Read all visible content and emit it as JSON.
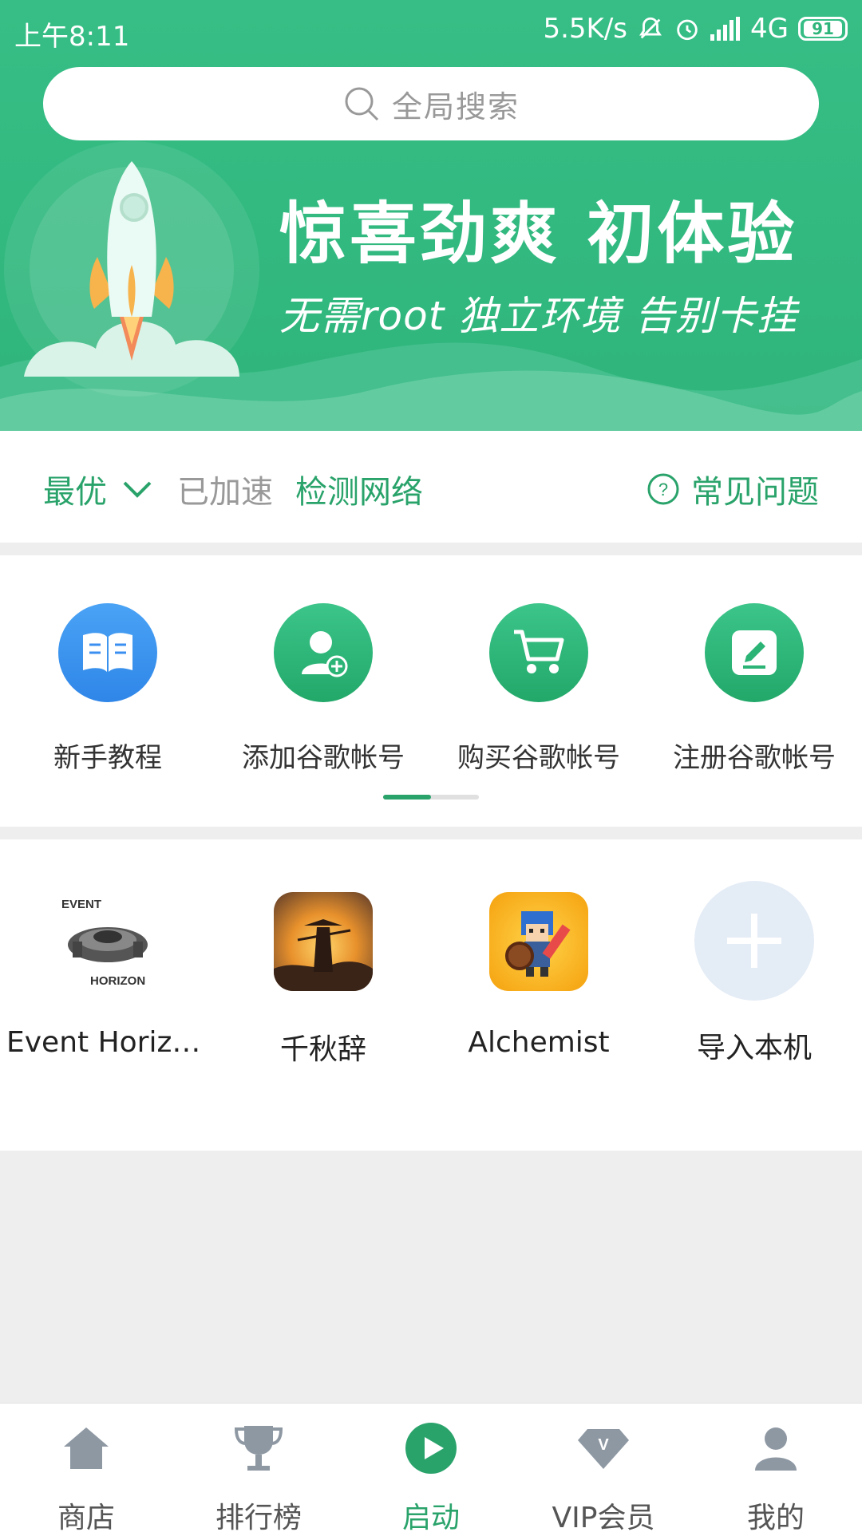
{
  "status_bar": {
    "time": "上午8:11",
    "net_speed": "5.5K/s",
    "network": "4G",
    "battery": "91"
  },
  "search": {
    "placeholder": "全局搜索"
  },
  "banner": {
    "headline": "惊喜劲爽  初体验",
    "subline": "无需root  独立环境  告别卡挂"
  },
  "network_row": {
    "mode": "最优",
    "status": "已加速",
    "check": "检测网络",
    "faq": "常见问题"
  },
  "quick_actions": [
    {
      "label": "新手教程",
      "icon": "book-icon",
      "color": "#3b8ff0"
    },
    {
      "label": "添加谷歌帐号",
      "icon": "add-user-icon",
      "color": "#2cb476"
    },
    {
      "label": "购买谷歌帐号",
      "icon": "cart-icon",
      "color": "#2cb476"
    },
    {
      "label": "注册谷歌帐号",
      "icon": "edit-icon",
      "color": "#2cb476"
    }
  ],
  "pager": {
    "active_page": 1,
    "total_pages": 2
  },
  "apps": [
    {
      "label": "Event Horizon...",
      "icon": "event-horizon-app-icon",
      "icon_text_top": "EVENT",
      "icon_text_bottom": "HORIZON"
    },
    {
      "label": "千秋辞",
      "icon": "qianqiuci-app-icon"
    },
    {
      "label": "Alchemist",
      "icon": "alchemist-app-icon"
    },
    {
      "label": "导入本机",
      "icon": "plus-icon"
    }
  ],
  "bottom_nav": [
    {
      "label": "商店",
      "icon": "home-icon",
      "active": false
    },
    {
      "label": "排行榜",
      "icon": "trophy-icon",
      "active": false
    },
    {
      "label": "启动",
      "icon": "play-icon",
      "active": true
    },
    {
      "label": "VIP会员",
      "icon": "diamond-icon",
      "active": false
    },
    {
      "label": "我的",
      "icon": "user-icon",
      "active": false
    }
  ],
  "colors": {
    "brand_green": "#2fb57b",
    "accent_green": "#2aa36b",
    "blue": "#3b8ff0"
  }
}
